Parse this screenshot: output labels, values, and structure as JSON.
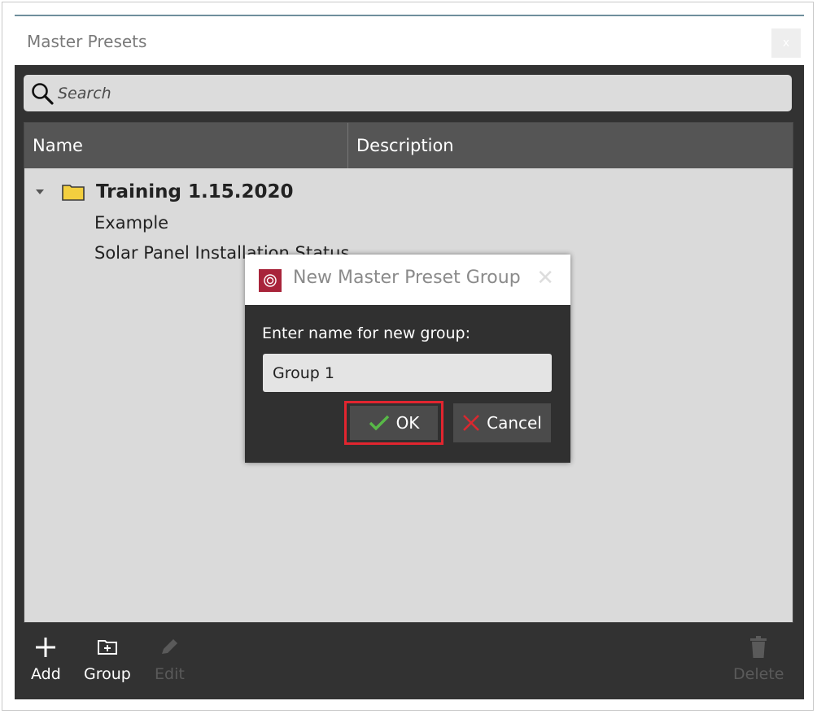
{
  "window": {
    "title": "Master Presets",
    "close_glyph": "x"
  },
  "search": {
    "placeholder": "Search",
    "icon": "search-icon"
  },
  "table": {
    "columns": [
      "Name",
      "Description"
    ],
    "group": {
      "label": "Training 1.15.2020",
      "icon": "folder-icon",
      "expanded": true,
      "folder_color": "#f3cf3f"
    },
    "items": [
      "Example",
      "Solar Panel Installation Status"
    ]
  },
  "toolbar": {
    "add_label": "Add",
    "group_label": "Group",
    "edit_label": "Edit",
    "delete_label": "Delete"
  },
  "dialog": {
    "title": "New Master Preset Group",
    "prompt": "Enter name for new group:",
    "name_value": "Group 1",
    "ok_label": "OK",
    "cancel_label": "Cancel",
    "highlight_color": "#e2252f",
    "ok_icon_color": "#58b947",
    "cancel_icon_color": "#d9282f"
  }
}
